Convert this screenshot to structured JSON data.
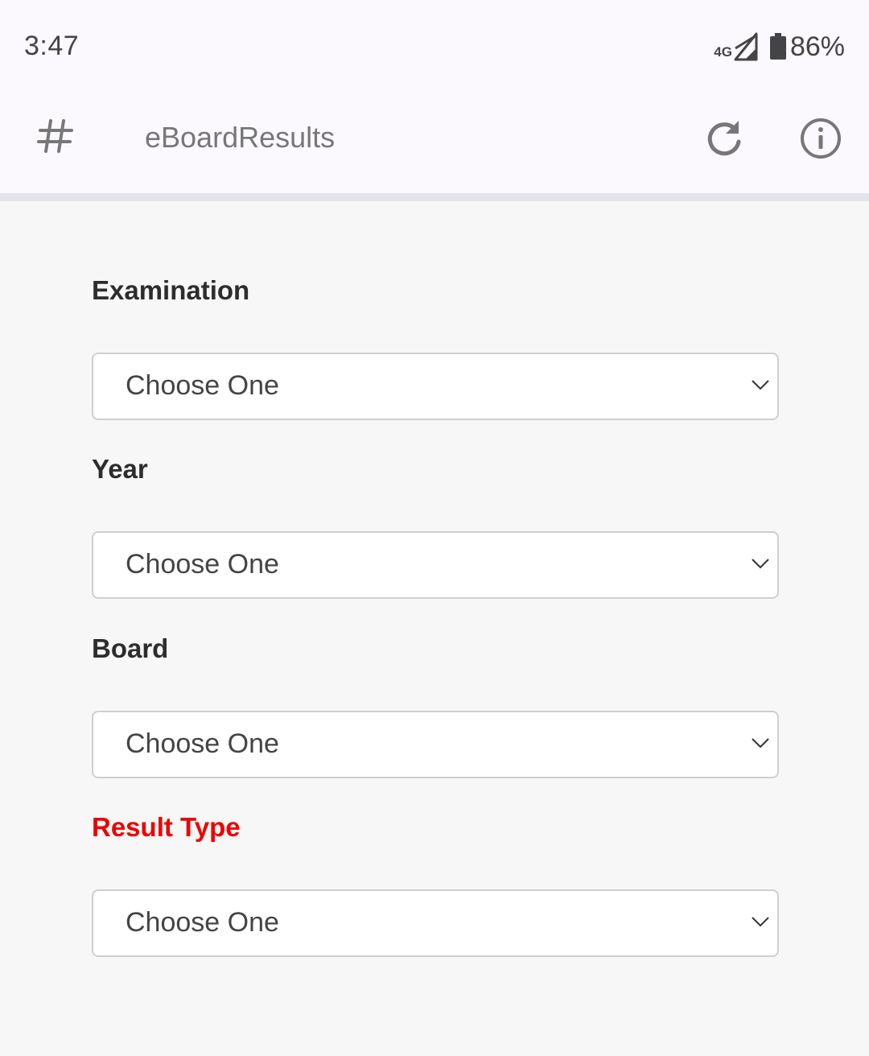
{
  "status_bar": {
    "time": "3:47",
    "network": "4G",
    "battery": "86%"
  },
  "app_bar": {
    "title": "eBoardResults",
    "left_icon": "hash-icon",
    "actions": [
      "refresh-icon",
      "info-icon"
    ]
  },
  "form": {
    "fields": [
      {
        "label": "Examination",
        "value": "Choose One"
      },
      {
        "label": "Year",
        "value": "Choose One"
      },
      {
        "label": "Board",
        "value": "Choose One"
      },
      {
        "label": "Result Type",
        "value": "Choose One"
      }
    ]
  },
  "colors": {
    "required_label": "#ee0000",
    "background": "#f7f7f7",
    "topbar": "#fbf9fe"
  }
}
